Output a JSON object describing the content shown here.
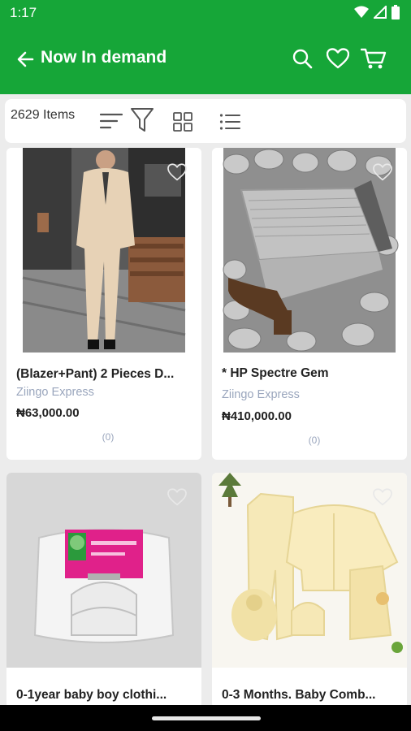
{
  "statusbar": {
    "time": "1:17",
    "icons": [
      "wifi-icon",
      "signal-icon",
      "battery-icon"
    ]
  },
  "appbar": {
    "back_icon": "arrow-left-icon",
    "title": "Now In demand",
    "actions": [
      "search-icon",
      "heart-icon",
      "cart-icon"
    ]
  },
  "toolbar": {
    "item_count": "2629 Items",
    "icons": [
      "sort-icon",
      "filter-icon",
      "grid-view-icon",
      "list-view-icon"
    ]
  },
  "products": [
    {
      "name": "(Blazer+Pant) 2 Pieces D...",
      "seller": "Ziingo Express",
      "price": "₦63,000.00",
      "reviews": "(0)"
    },
    {
      "name": "* HP Spectre Gem",
      "seller": "Ziingo Express",
      "price": "₦410,000.00",
      "reviews": "(0)"
    },
    {
      "name": "0-1year baby boy clothi...",
      "seller": "",
      "price": "",
      "reviews": ""
    },
    {
      "name": "0-3 Months. Baby Comb...",
      "seller": "",
      "price": "",
      "reviews": ""
    }
  ],
  "colors": {
    "brand": "#16a638",
    "muted": "#9aa6bd"
  }
}
